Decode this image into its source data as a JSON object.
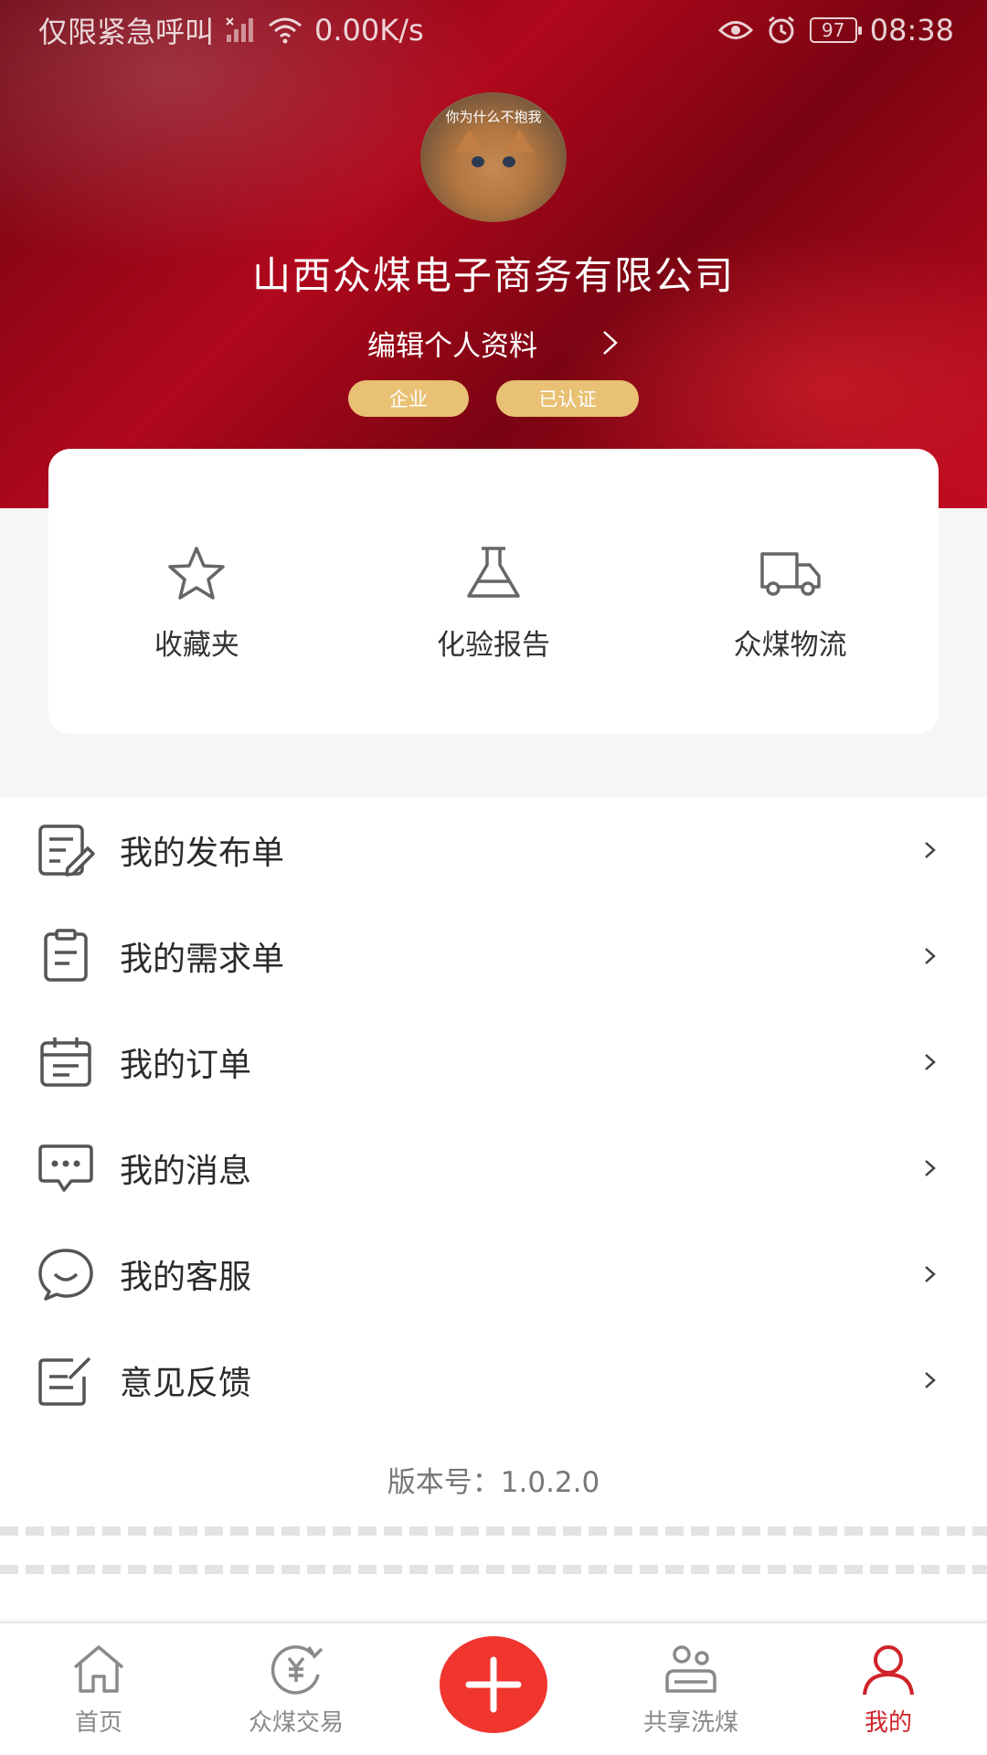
{
  "status_bar": {
    "carrier": "仅限紧急呼叫",
    "speed": "0.00K/s",
    "battery": "97",
    "time": "08:38",
    "icons": [
      "signal-icon",
      "wifi-icon",
      "eye-icon",
      "alarm-icon",
      "battery-icon"
    ]
  },
  "profile": {
    "avatar_caption": "你为什么不抱我",
    "company_name": "山西众煤电子商务有限公司",
    "edit_label": "编辑个人资料",
    "badges": [
      "企业",
      "已认证"
    ],
    "badge_color": "#e8c174",
    "hero_color": "#b0081c"
  },
  "quick_actions": [
    {
      "label": "收藏夹",
      "icon": "star-icon"
    },
    {
      "label": "化验报告",
      "icon": "flask-icon"
    },
    {
      "label": "众煤物流",
      "icon": "truck-icon"
    }
  ],
  "menu": [
    {
      "label": "我的发布单",
      "icon": "edit-document-icon"
    },
    {
      "label": "我的需求单",
      "icon": "clipboard-icon"
    },
    {
      "label": "我的订单",
      "icon": "calendar-icon"
    },
    {
      "label": "我的消息",
      "icon": "message-icon"
    },
    {
      "label": "我的客服",
      "icon": "customer-service-icon"
    },
    {
      "label": "意见反馈",
      "icon": "feedback-icon"
    }
  ],
  "version": "版本号：1.0.2.0",
  "bottom_nav": [
    {
      "label": "首页",
      "icon": "home-icon"
    },
    {
      "label": "众煤交易",
      "icon": "currency-exchange-icon"
    },
    {
      "label": "",
      "icon": "plus-icon"
    },
    {
      "label": "共享洗煤",
      "icon": "shared-wash-icon"
    },
    {
      "label": "我的",
      "icon": "user-icon"
    }
  ],
  "colors": {
    "active_tab": "#d0232a",
    "fab": "#f0352f"
  }
}
